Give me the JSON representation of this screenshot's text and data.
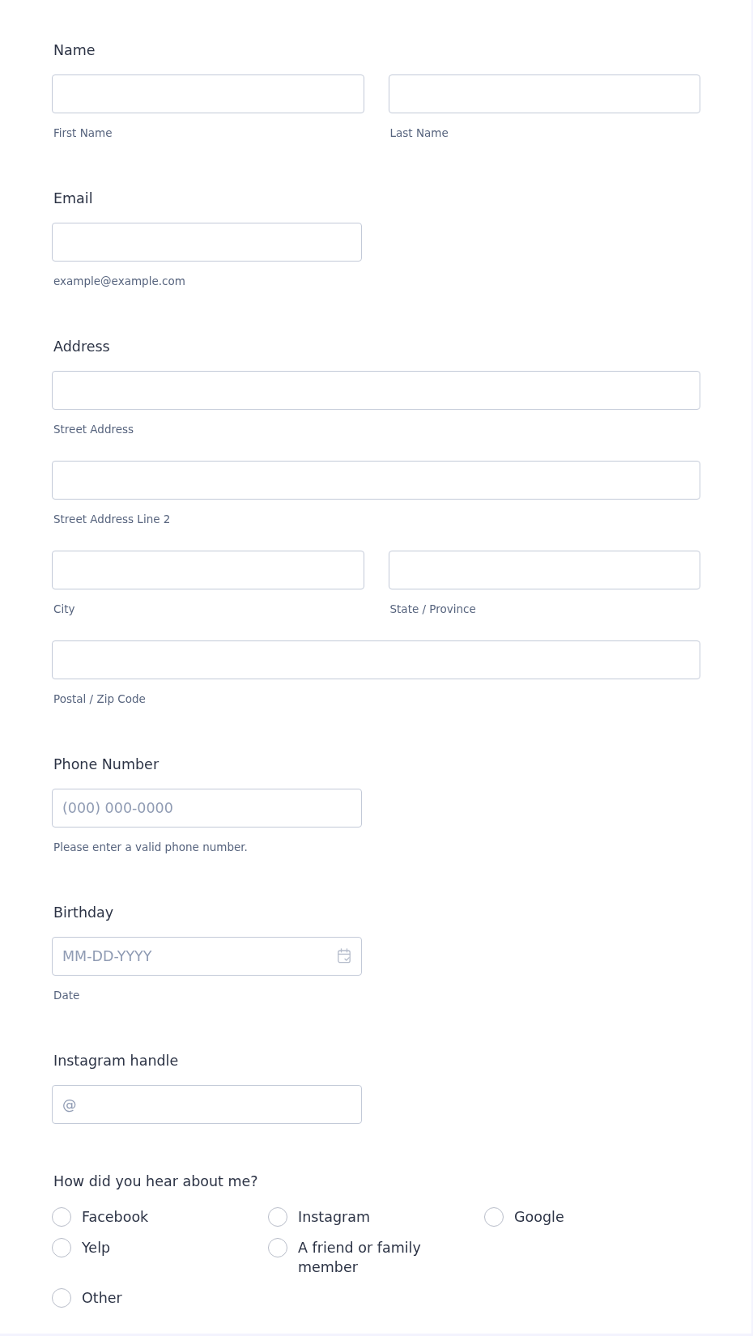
{
  "sections": [
    {
      "kind": "group",
      "label": "Name",
      "rows": [
        [
          {
            "kind": "text",
            "sublabel": "First Name"
          },
          {
            "kind": "text",
            "sublabel": "Last Name"
          }
        ]
      ]
    },
    {
      "kind": "short",
      "label": "Email",
      "rows": [
        [
          {
            "kind": "text",
            "sublabel": "example@example.com"
          }
        ]
      ]
    },
    {
      "kind": "group",
      "label": "Address",
      "rows": [
        [
          {
            "kind": "text",
            "sublabel": "Street Address"
          }
        ],
        [
          {
            "kind": "text",
            "sublabel": "Street Address Line 2"
          }
        ],
        [
          {
            "kind": "text",
            "sublabel": "City"
          },
          {
            "kind": "text",
            "sublabel": "State / Province"
          }
        ],
        [
          {
            "kind": "text",
            "sublabel": "Postal / Zip Code"
          }
        ]
      ]
    },
    {
      "kind": "short",
      "label": "Phone Number",
      "rows": [
        [
          {
            "kind": "text",
            "placeholder": "(000) 000-0000",
            "sublabel": "Please enter a valid phone number."
          }
        ]
      ]
    },
    {
      "kind": "short",
      "label": "Birthday",
      "rows": [
        [
          {
            "kind": "date",
            "placeholder": "MM-DD-YYYY",
            "sublabel": "Date"
          }
        ]
      ]
    },
    {
      "kind": "short",
      "label": "Instagram handle",
      "rows": [
        [
          {
            "kind": "text",
            "placeholder": "@"
          }
        ]
      ]
    },
    {
      "kind": "radio",
      "label": "How did you hear about me?",
      "option_rows": [
        [
          {
            "label": "Facebook",
            "selected": false
          },
          {
            "label": "Instagram",
            "selected": false
          },
          {
            "label": "Google",
            "selected": false
          }
        ],
        [
          {
            "label": "Yelp",
            "selected": false
          },
          {
            "label": "A friend or family member",
            "selected": false
          }
        ],
        [
          {
            "label": "Other",
            "selected": false
          }
        ]
      ]
    }
  ]
}
